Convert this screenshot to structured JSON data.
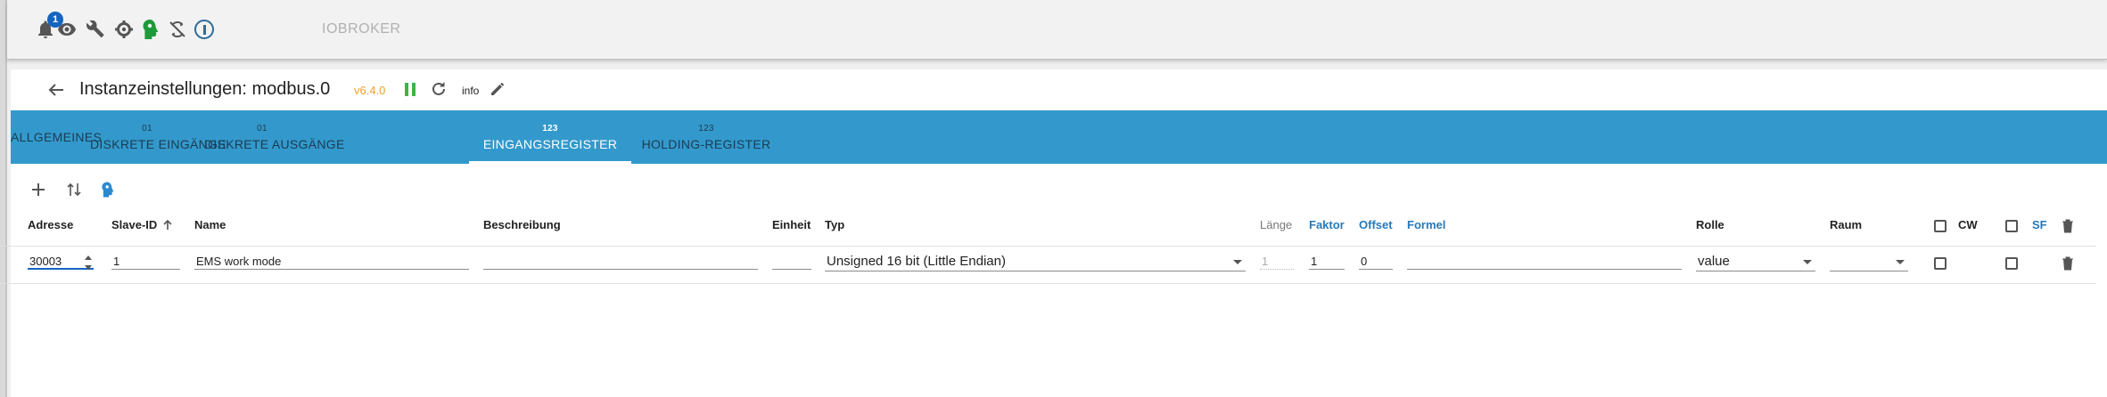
{
  "topbar": {
    "notification_count": "1",
    "brand": "IOBROKER",
    "icons": [
      "bell-icon",
      "eye-icon",
      "wrench-icon",
      "gear-icon",
      "head-icon",
      "sync-off-icon",
      "iobroker-logo-icon"
    ]
  },
  "header": {
    "title": "Instanzeinstellungen: modbus.0",
    "version": "v6.4.0",
    "info_label": "info"
  },
  "tabs": [
    {
      "top": "",
      "label": "ALLGEMEINES"
    },
    {
      "top": "01",
      "label": "DISKRETE EINGÄNGE"
    },
    {
      "top": "01",
      "label": "DISKRETE AUSGÄNGE"
    },
    {
      "top": "123",
      "label": "EINGANGSREGISTER",
      "active": true
    },
    {
      "top": "123",
      "label": "HOLDING-REGISTER"
    }
  ],
  "table": {
    "headers": {
      "adresse": "Adresse",
      "slave_id": "Slave-ID",
      "name": "Name",
      "beschreibung": "Beschreibung",
      "einheit": "Einheit",
      "typ": "Typ",
      "laenge": "Länge",
      "faktor": "Faktor",
      "offset": "Offset",
      "formel": "Formel",
      "rolle": "Rolle",
      "raum": "Raum",
      "cw": "CW",
      "sf": "SF"
    },
    "row": {
      "adresse": "30003",
      "slave_id": "1",
      "name": "EMS work mode",
      "beschreibung": "",
      "einheit": "",
      "typ": "Unsigned 16 bit (Little Endian)",
      "laenge": "1",
      "faktor": "1",
      "offset": "0",
      "formel": "",
      "rolle": "value",
      "raum": ""
    }
  },
  "colors": {
    "tab_bar": "#3399cc",
    "version": "#f0a02c",
    "pause": "#41b24a",
    "link_header": "#2979b8"
  }
}
